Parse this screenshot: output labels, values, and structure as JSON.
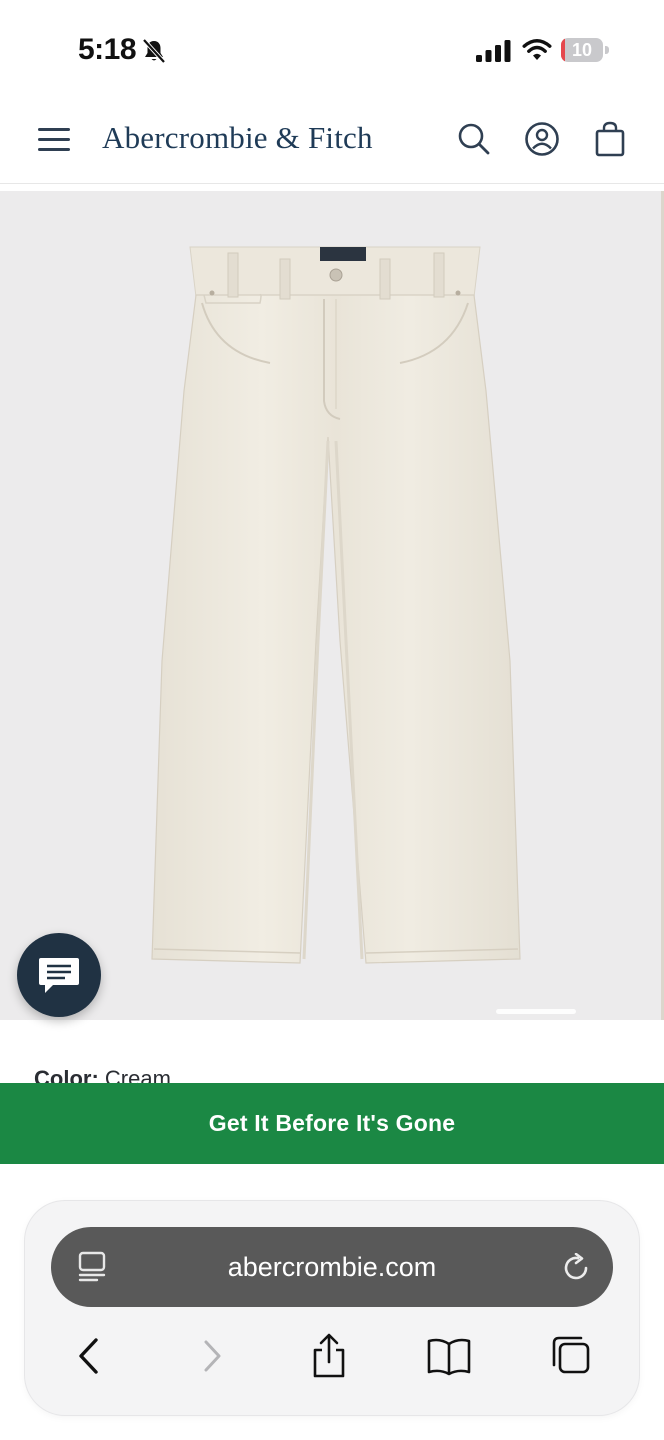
{
  "status_bar": {
    "time": "5:18",
    "battery": "10",
    "battery_level": 0.1,
    "icons": [
      "bell-slash-icon",
      "cellular-signal-icon",
      "wifi-icon",
      "battery-icon"
    ]
  },
  "header": {
    "brand": "Abercrombie & Fitch",
    "icons": [
      "hamburger-menu-icon",
      "search-icon",
      "account-icon",
      "shopping-bag-icon"
    ]
  },
  "product": {
    "image_subject": "cream jeans",
    "color_label": "Color:",
    "color_value": "Cream"
  },
  "chat": {
    "icon": "chat-bubble-icon"
  },
  "promo": {
    "text": "Get It Before It's Gone"
  },
  "browser": {
    "url": "abercrombie.com",
    "icons": [
      "reader-mode-icon",
      "reload-icon",
      "back-icon",
      "forward-icon",
      "share-icon",
      "bookmarks-icon",
      "tabs-icon"
    ]
  },
  "colors": {
    "brand_navy": "#1f3b57",
    "promo_green": "#1b8844",
    "chat_navy": "#203243",
    "gallery_bg": "#ecebec",
    "address_bar": "#595959"
  }
}
